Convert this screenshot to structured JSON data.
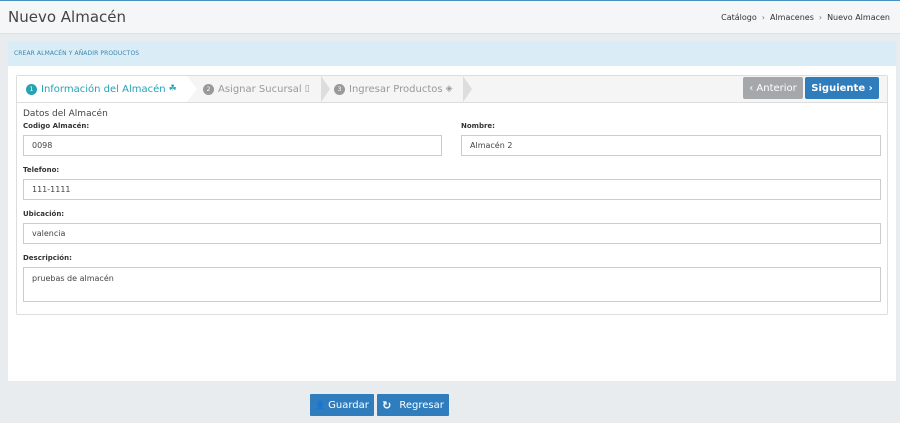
{
  "header": {
    "title": "Nuevo Almacén",
    "breadcrumb": [
      "Catálogo",
      "Almacenes",
      "Nuevo Almacen"
    ],
    "separator": "›"
  },
  "panel": {
    "title": "CREAR ALMACÉN Y AÑADIR PRODUCTOS"
  },
  "wizard": {
    "steps": [
      {
        "num": "1",
        "label": "Información del Almacén",
        "icon": "☘"
      },
      {
        "num": "2",
        "label": "Asignar Sucursal",
        "icon": "▯"
      },
      {
        "num": "3",
        "label": "Ingresar Productos",
        "icon": "◈"
      }
    ],
    "prev_label": "‹ Anterior",
    "next_label": "Siguiente ›"
  },
  "form": {
    "section_title": "Datos del Almacén",
    "codigo": {
      "label": "Codigo Almacén:",
      "value": "0098"
    },
    "nombre": {
      "label": "Nombre:",
      "value": "Almacén 2"
    },
    "telefono": {
      "label": "Telefono:",
      "value": "111-1111"
    },
    "ubicacion": {
      "label": "Ubicación:",
      "value": "valencia"
    },
    "descripcion": {
      "label": "Descripción:",
      "value": "pruebas de almacén"
    }
  },
  "actions": {
    "save_icon": "👤",
    "save_label": "Guardar",
    "back_icon": "↻",
    "back_label": "Regresar"
  },
  "colors": {
    "accent": "#23a3b6",
    "primary": "#2f7dbd",
    "muted": "#a5a8ab"
  }
}
